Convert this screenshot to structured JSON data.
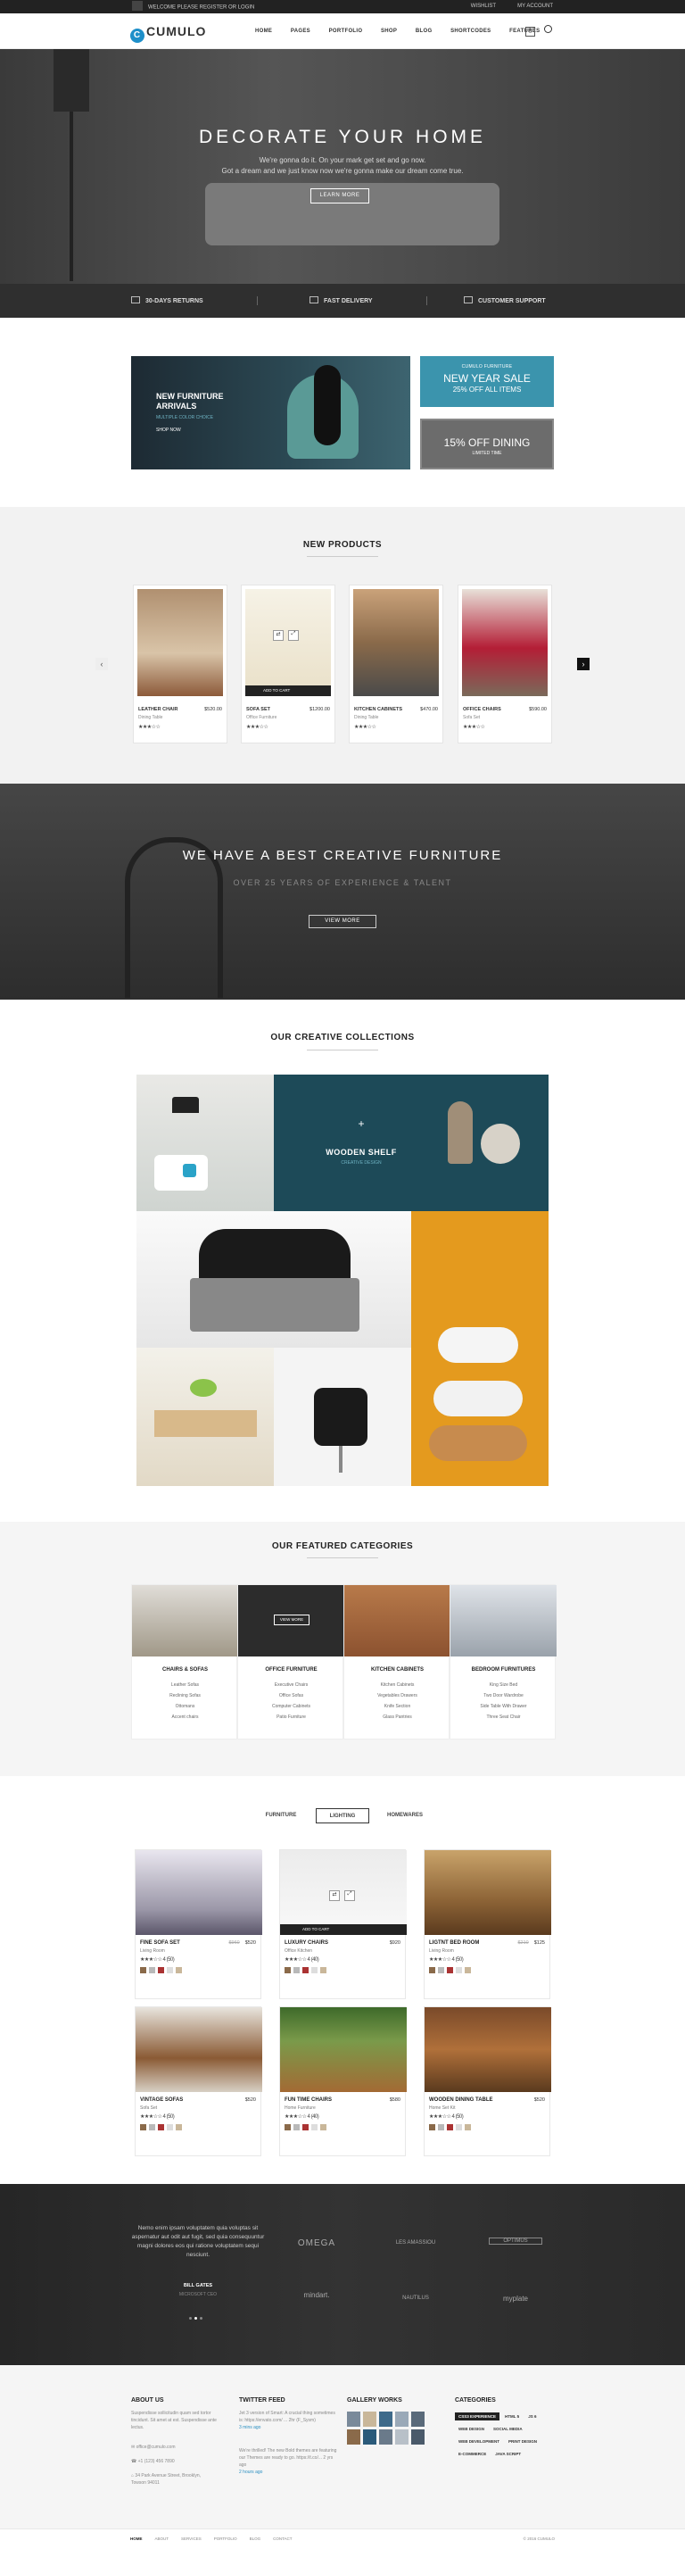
{
  "topbar": {
    "welcome": "WELCOME PLEASE REGISTER OR LOGIN",
    "wishlist": "WISHLIST",
    "account": "MY ACCOUNT"
  },
  "header": {
    "logo_mark": "C",
    "logo_text": "CUMULO",
    "nav": [
      "HOME",
      "PAGES",
      "PORTFOLIO",
      "SHOP",
      "BLOG",
      "SHORTCODES",
      "FEATURES"
    ],
    "cart_count": "0"
  },
  "hero": {
    "title": "DECORATE YOUR HOME",
    "line1": "We're gonna do it. On your mark get set and go now.",
    "line2": "Got a dream and we just know now we're gonna make our dream come true.",
    "button": "LEARN MORE"
  },
  "features": [
    "30-DAYS RETURNS",
    "FAST DELIVERY",
    "CUSTOMER SUPPORT"
  ],
  "promos": {
    "main": {
      "title": "NEW FURNITURE ARRIVALS",
      "sub": "MULTIPLE COLOR CHOICE",
      "link": "SHOP NOW"
    },
    "a": {
      "kicker": "CUMULO FURNITURE",
      "title": "NEW YEAR SALE",
      "sub": "25% OFF ALL ITEMS"
    },
    "b": {
      "title": "15% OFF DINING",
      "sub": "LIMITED TIME"
    }
  },
  "new_products": {
    "title": "NEW PRODUCTS",
    "add_to_cart": "ADD TO CART",
    "items": [
      {
        "name": "LEATHER CHAIR",
        "price": "$520.00",
        "category": "Dining Table",
        "stars": "★★★☆☆"
      },
      {
        "name": "SOFA SET",
        "price": "$1200.00",
        "category": "Office Furniture",
        "stars": "★★★☆☆"
      },
      {
        "name": "KITCHEN CABINETS",
        "price": "$470.00",
        "category": "Dining Table",
        "stars": "★★★☆☆"
      },
      {
        "name": "OFFICE CHAIRS",
        "price": "$590.00",
        "category": "Sofa Set",
        "stars": "★★★☆☆"
      }
    ]
  },
  "creative": {
    "title": "WE HAVE A BEST CREATIVE FURNITURE",
    "sub": "OVER 25 YEARS OF EXPERIENCE & TALENT",
    "button": "VIEW MORE"
  },
  "collections": {
    "title": "OUR CREATIVE COLLECTIONS",
    "overlay_plus": "+",
    "overlay_title": "WOODEN SHELF",
    "overlay_sub": "CREATIVE DESIGN"
  },
  "categories": {
    "title": "OUR FEATURED CATEGORIES",
    "view_label": "VIEW MORE",
    "items": [
      {
        "title": "CHAIRS & SOFAS",
        "links": [
          "Leather Sofas",
          "Reclining Sofas",
          "Ottomans",
          "Accent chairs"
        ]
      },
      {
        "title": "OFFICE FURNITURE",
        "links": [
          "Executive Chairs",
          "Office Sofas",
          "Computer Cabinets",
          "Patio Furniture"
        ]
      },
      {
        "title": "KITCHEN CABINETS",
        "links": [
          "Kitchen Cabinets",
          "Vegetables Drawers",
          "Knife Section",
          "Glass Pantries"
        ]
      },
      {
        "title": "BEDROOM FURNITURES",
        "links": [
          "King Size Bed",
          "Two Door Wardrobe",
          "Side Table With Drawer",
          "Three Seat Chair"
        ]
      }
    ]
  },
  "tabs": [
    "FURNITURE",
    "LIGHTING",
    "HOMEWARES"
  ],
  "shop": {
    "add_to_cart": "ADD TO CART",
    "items": [
      {
        "name": "FINE SOFA SET",
        "old": "$960",
        "price": "$520",
        "category": "Living Room",
        "stars": "★★★☆☆ 4 (50)"
      },
      {
        "name": "LUXURY CHAIRS",
        "old": "",
        "price": "$920",
        "category": "Office Kitchen",
        "stars": "★★★☆☆ 4 (40)"
      },
      {
        "name": "LIGTNT BED ROOM",
        "old": "$210",
        "price": "$125",
        "category": "Living Room",
        "stars": "★★★☆☆ 4 (50)"
      },
      {
        "name": "VINTAGE SOFAS",
        "old": "",
        "price": "$520",
        "category": "Sofa Set",
        "stars": "★★★☆☆ 4 (50)"
      },
      {
        "name": "FUN TIME CHAIRS",
        "old": "",
        "price": "$580",
        "category": "Home Furniture",
        "stars": "★★★☆☆ 4 (40)"
      },
      {
        "name": "WOODEN DINING TABLE",
        "old": "",
        "price": "$520",
        "category": "Home Set Kit",
        "stars": "★★★☆☆ 4 (50)"
      }
    ]
  },
  "testimonial": {
    "quote": "Nemo enim ipsam voluptatem quia voluptas sit aspernatur aut odit aut fugit, sed quia consequuntur magni dolores eos qui ratione voluptatem sequi nesciunt.",
    "name": "BILL GATES",
    "role": "MICROSOFT CEO"
  },
  "brands": [
    "OMEGA",
    "LES AMASSIOU",
    "OPTIMUS",
    "mindart.",
    "NAUTILUS",
    "myplate"
  ],
  "footer": {
    "about": {
      "title": "ABOUT US",
      "text": "Suspendisse sollicitudin quam sed tortor tincidunt. Sit amet at est. Suspendisse ante lectus.",
      "email": "office@cumulo.com",
      "phone": "+1 (123) 456 7890",
      "address": "34 Park Avenue Street, Brooklyn, Towson 94011"
    },
    "twitter": {
      "title": "TWITTER FEED",
      "t1": "Jet 3 version of Smart: A crucial thing sometimes is: https://envato.com/ ... 2hr (F_Sysm)",
      "t1_time": "3 mins ago",
      "t2": "We're thrilled! The new Bold themes are featuring our Themes are ready to go. https://t.co/... 2 yrs ago",
      "t2_time": "2 hours ago"
    },
    "gallery": {
      "title": "GALLERY WORKS"
    },
    "cats": {
      "title": "CATEGORIES",
      "tags": [
        "CSS3 EXPERIENCE",
        "HTML 5",
        "JS 6",
        "WEB DESIGN",
        "SOCIAL MEDIA",
        "WEB DEVELOPMENT",
        "PRINT DESIGN",
        "E-COMMERCE",
        "JAVA SCRIPT"
      ]
    }
  },
  "bottom": {
    "links": [
      "HOME",
      "ABOUT",
      "SERVICES",
      "PORTFOLIO",
      "BLOG",
      "CONTACT"
    ],
    "copyright": "© 2016 CUMULO"
  }
}
